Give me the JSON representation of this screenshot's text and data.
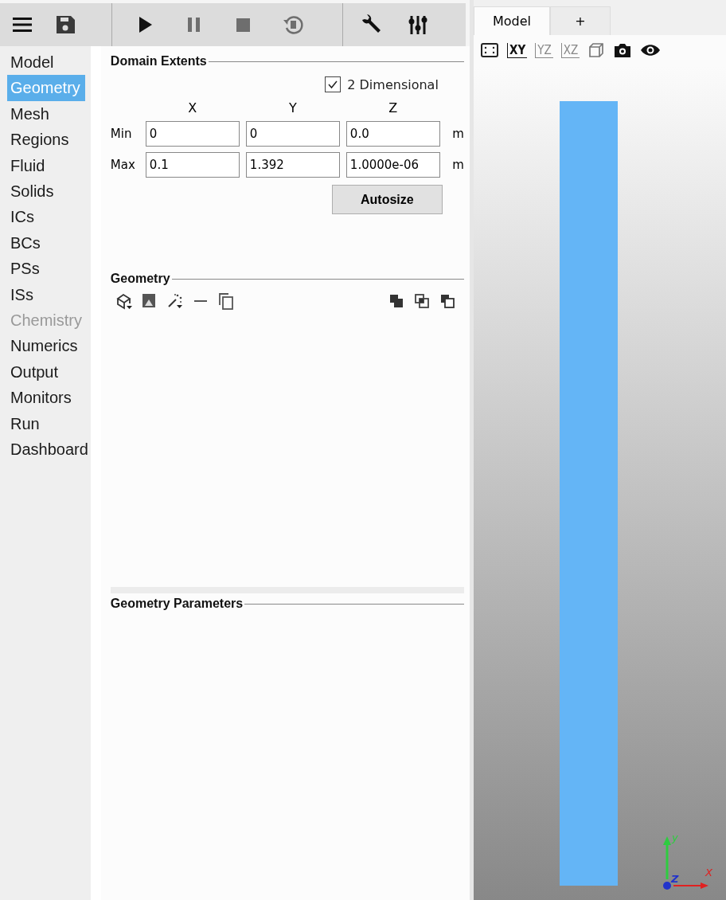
{
  "toolbar": [
    {
      "kind": "menu",
      "disabled": false
    },
    {
      "kind": "save",
      "disabled": false
    },
    {
      "kind": "play",
      "disabled": false
    },
    {
      "kind": "pause",
      "disabled": true
    },
    {
      "kind": "stop",
      "disabled": true
    },
    {
      "kind": "reset",
      "disabled": true
    },
    {
      "kind": "wrench",
      "disabled": false
    },
    {
      "kind": "sliders",
      "disabled": false
    }
  ],
  "sidebar": {
    "items": [
      {
        "label": "Model",
        "selected": false,
        "disabled": false
      },
      {
        "label": "Geometry",
        "selected": true,
        "disabled": false
      },
      {
        "label": "Mesh",
        "selected": false,
        "disabled": false
      },
      {
        "label": "Regions",
        "selected": false,
        "disabled": false
      },
      {
        "label": "Fluid",
        "selected": false,
        "disabled": false
      },
      {
        "label": "Solids",
        "selected": false,
        "disabled": false
      },
      {
        "label": "ICs",
        "selected": false,
        "disabled": false
      },
      {
        "label": "BCs",
        "selected": false,
        "disabled": false
      },
      {
        "label": "PSs",
        "selected": false,
        "disabled": false
      },
      {
        "label": "ISs",
        "selected": false,
        "disabled": false
      },
      {
        "label": "Chemistry",
        "selected": false,
        "disabled": true
      },
      {
        "label": "Numerics",
        "selected": false,
        "disabled": false
      },
      {
        "label": "Output",
        "selected": false,
        "disabled": false
      },
      {
        "label": "Monitors",
        "selected": false,
        "disabled": false
      },
      {
        "label": "Run",
        "selected": false,
        "disabled": false
      },
      {
        "label": "Dashboard",
        "selected": false,
        "disabled": false
      }
    ]
  },
  "domain_extents": {
    "title": "Domain Extents",
    "two_dimensional": {
      "label": "2 Dimensional",
      "checked": true
    },
    "columns": [
      "X",
      "Y",
      "Z"
    ],
    "rows": [
      {
        "label": "Min",
        "values": [
          "0",
          "0",
          "0.0"
        ],
        "unit": "m"
      },
      {
        "label": "Max",
        "values": [
          "0.1",
          "1.392",
          "1.0000e-06"
        ],
        "unit": "m"
      }
    ],
    "autosize_button": "Autosize"
  },
  "geometry": {
    "title": "Geometry"
  },
  "geometry_parameters": {
    "title": "Geometry Parameters"
  },
  "viewport": {
    "tabs": [
      {
        "label": "Model",
        "selected": true
      },
      {
        "label": "+",
        "selected": false
      }
    ],
    "view_buttons": [
      {
        "label": "XY",
        "disabled": false
      },
      {
        "label": "YZ",
        "disabled": true
      },
      {
        "label": "XZ",
        "disabled": true
      }
    ],
    "axes": [
      {
        "label": "y",
        "color": "#2ecc40"
      },
      {
        "label": "Z",
        "color": "#2233cc"
      },
      {
        "label": "X",
        "color": "#e02020"
      }
    ]
  }
}
